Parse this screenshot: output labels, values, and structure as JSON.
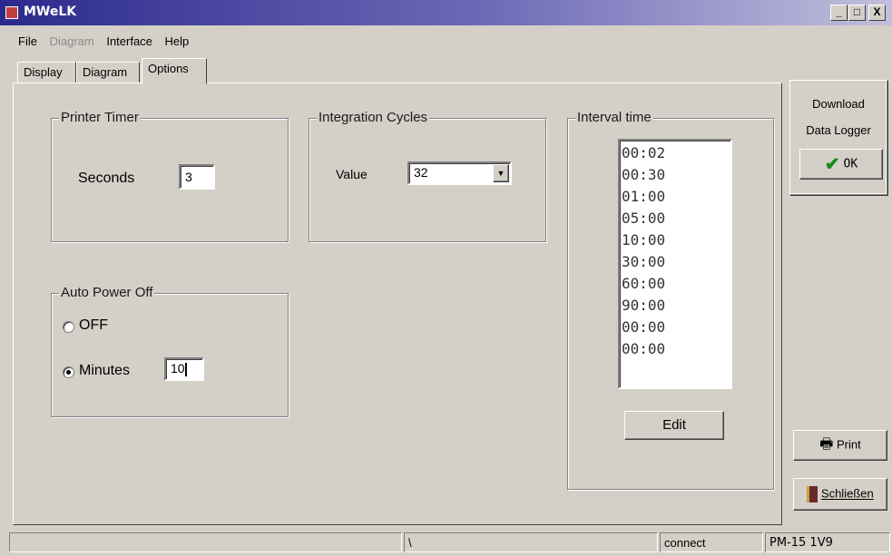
{
  "window": {
    "title": "MWeLK",
    "controls": [
      "_",
      "□",
      "X"
    ]
  },
  "menu": [
    {
      "label": "File",
      "enabled": true
    },
    {
      "label": "Diagram",
      "enabled": false
    },
    {
      "label": "Interface",
      "enabled": true
    },
    {
      "label": "Help",
      "enabled": true
    }
  ],
  "tabs": [
    "Display",
    "Diagram",
    "Options"
  ],
  "active_tab": "Options",
  "printer_timer": {
    "label": "Printer Timer",
    "field_label": "Seconds",
    "value": "3"
  },
  "integration_cycles": {
    "label": "Integration Cycles",
    "field_label": "Value",
    "selected": "32"
  },
  "interval_time": {
    "label": "Interval time",
    "items": [
      "00:02",
      "00:30",
      "01:00",
      "05:00",
      "10:00",
      "30:00",
      "60:00",
      "90:00",
      "00:00",
      "00:00"
    ],
    "edit_label": "Edit"
  },
  "auto_power_off": {
    "label": "Auto Power Off",
    "off_label": "OFF",
    "minutes_label": "Minutes",
    "minutes_value": "10",
    "selected": "Minutes"
  },
  "side": {
    "download_line1": "Download",
    "download_line2": "Data Logger",
    "ok_label": "OK",
    "print_label": "Print",
    "close_label": "Schließen"
  },
  "status": {
    "seg2": "\\",
    "seg3": "connect",
    "seg4": "PM-15  1V9"
  },
  "colors": {
    "face": "#d4d0c8",
    "title_start": "#2b2a8c",
    "check_green": "#1a8a1a"
  }
}
